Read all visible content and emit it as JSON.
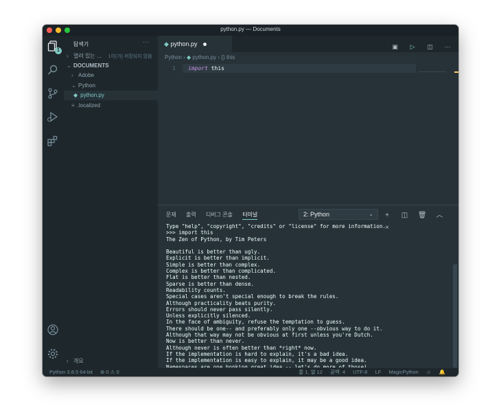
{
  "window": {
    "title": "python.py — Documents"
  },
  "activity": {
    "badge": "1"
  },
  "sidebar": {
    "title": "탐색기",
    "more": "···",
    "open_editors": "열려 있는 ...",
    "unsaved": "1이(가) 저장되지 않음",
    "root": "DOCUMENTS",
    "items": [
      {
        "label": "Adobe",
        "type": "folder",
        "state": "collapsed"
      },
      {
        "label": "Python",
        "type": "folder",
        "state": "expanded"
      },
      {
        "label": "python.py",
        "type": "file",
        "selected": true
      },
      {
        "label": ".localized",
        "type": "file"
      }
    ],
    "outline": "개요"
  },
  "editor": {
    "tab": {
      "label": "python.py",
      "dirty": true
    },
    "breadcrumb": {
      "folder": "Python",
      "file": "python.py",
      "symbol_icon": "{}",
      "symbol": "this"
    },
    "line_number": "1",
    "code": {
      "keyword": "import",
      "rest": " this"
    }
  },
  "panel": {
    "tabs": [
      "문제",
      "출력",
      "디버그 콘솔",
      "터미널"
    ],
    "active_tab": "터미널",
    "terminal_select": "2: Python",
    "terminal": "Type \"help\", \"copyright\", \"credits\" or \"license\" for more information.\n>>> import this\nThe Zen of Python, by Tim Peters\n\nBeautiful is better than ugly.\nExplicit is better than implicit.\nSimple is better than complex.\nComplex is better than complicated.\nFlat is better than nested.\nSparse is better than dense.\nReadability counts.\nSpecial cases aren't special enough to break the rules.\nAlthough practicality beats purity.\nErrors should never pass silently.\nUnless explicitly silenced.\nIn the face of ambiguity, refuse the temptation to guess.\nThere should be one-- and preferably only one --obvious way to do it.\nAlthough that way may not be obvious at first unless you're Dutch.\nNow is better than never.\nAlthough never is often better than *right* now.\nIf the implementation is hard to explain, it's a bad idea.\nIf the implementation is easy to explain, it may be a good idea.\nNamespaces are one honking great idea -- let's do more of those!",
    "prompt": ">>> "
  },
  "status": {
    "python": "Python 3.8.5 64-bit",
    "problems": "⊗ 0 ⚠ 0",
    "position": "줄 1, 열 12",
    "spaces": "공백: 4",
    "encoding": "UTF-8",
    "eol": "LF",
    "language": "MagicPython"
  },
  "colors": {
    "accent": "#80cbc4",
    "background": "#263238",
    "cursor": "#ffcc00"
  }
}
